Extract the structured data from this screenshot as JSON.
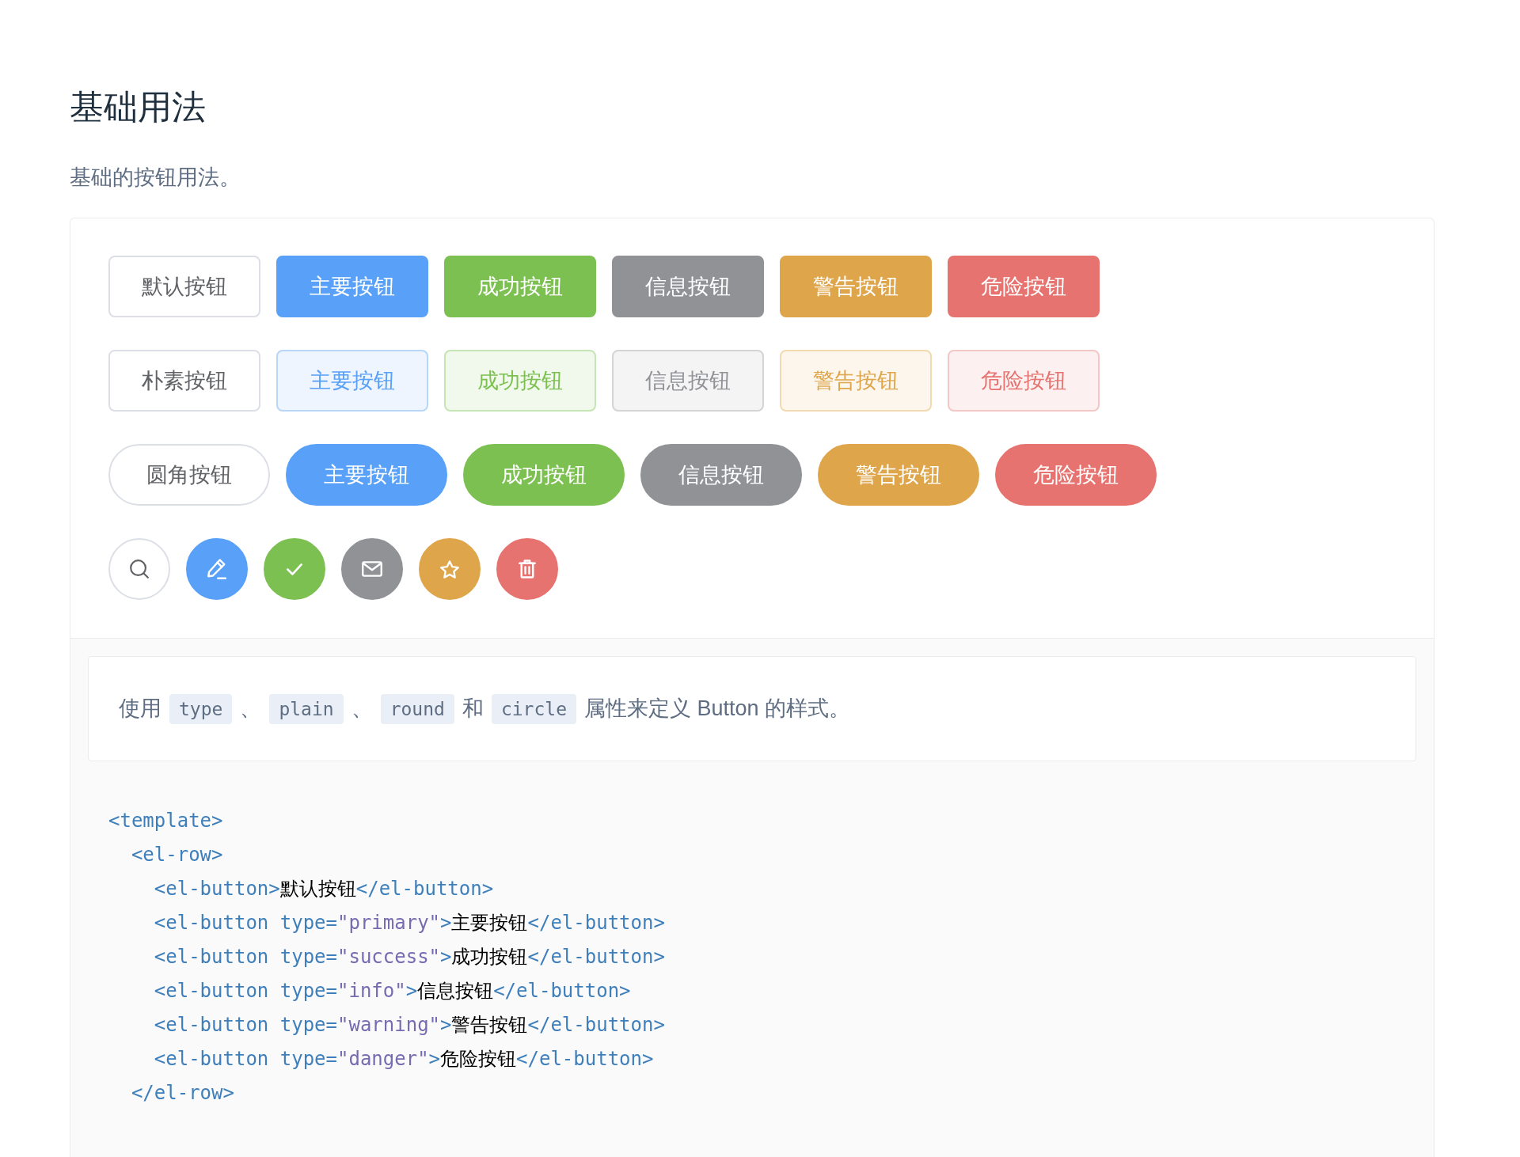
{
  "section": {
    "title": "基础用法",
    "description": "基础的按钮用法。"
  },
  "demo": {
    "rows": [
      {
        "kind": "solid",
        "buttons": [
          {
            "kind": "default",
            "label": "默认按钮"
          },
          {
            "kind": "primary",
            "label": "主要按钮"
          },
          {
            "kind": "success",
            "label": "成功按钮"
          },
          {
            "kind": "info",
            "label": "信息按钮"
          },
          {
            "kind": "warning",
            "label": "警告按钮"
          },
          {
            "kind": "danger",
            "label": "危险按钮"
          }
        ]
      },
      {
        "kind": "plain",
        "buttons": [
          {
            "kind": "default",
            "label": "朴素按钮"
          },
          {
            "kind": "primary",
            "label": "主要按钮"
          },
          {
            "kind": "success",
            "label": "成功按钮"
          },
          {
            "kind": "info",
            "label": "信息按钮"
          },
          {
            "kind": "warning",
            "label": "警告按钮"
          },
          {
            "kind": "danger",
            "label": "危险按钮"
          }
        ]
      },
      {
        "kind": "round",
        "buttons": [
          {
            "kind": "default",
            "label": "圆角按钮"
          },
          {
            "kind": "primary",
            "label": "主要按钮"
          },
          {
            "kind": "success",
            "label": "成功按钮"
          },
          {
            "kind": "info",
            "label": "信息按钮"
          },
          {
            "kind": "warning",
            "label": "警告按钮"
          },
          {
            "kind": "danger",
            "label": "危险按钮"
          }
        ]
      },
      {
        "kind": "circle",
        "buttons": [
          {
            "kind": "default"
          },
          {
            "kind": "primary"
          },
          {
            "kind": "success"
          },
          {
            "kind": "info"
          },
          {
            "kind": "warning"
          },
          {
            "kind": "danger"
          }
        ]
      }
    ]
  },
  "meta": {
    "description": [
      {
        "kind": "text",
        "text": "使用"
      },
      {
        "kind": "code",
        "text": "type"
      },
      {
        "kind": "text",
        "text": "、"
      },
      {
        "kind": "code",
        "text": "plain"
      },
      {
        "kind": "text",
        "text": "、"
      },
      {
        "kind": "code",
        "text": "round"
      },
      {
        "kind": "text",
        "text": "和"
      },
      {
        "kind": "code",
        "text": "circle"
      },
      {
        "kind": "text",
        "text": "属性来定义 Button 的样式。"
      }
    ],
    "code": [
      {
        "segments": [
          {
            "kind": "tag",
            "text": "<template>"
          }
        ],
        "children": [
          {
            "segments": [
              {
                "kind": "tag",
                "text": "<el-row>"
              }
            ],
            "children": [
              {
                "segments": [
                  {
                    "kind": "tag",
                    "text": "<el-button>"
                  },
                  {
                    "kind": "text",
                    "text": "默认按钮"
                  },
                  {
                    "kind": "tag",
                    "text": "</el-button>"
                  }
                ]
              },
              {
                "segments": [
                  {
                    "kind": "tag",
                    "text": "<el-button type="
                  },
                  {
                    "kind": "string",
                    "text": "\"primary\""
                  },
                  {
                    "kind": "tag",
                    "text": ">"
                  },
                  {
                    "kind": "text",
                    "text": "主要按钮"
                  },
                  {
                    "kind": "tag",
                    "text": "</el-button>"
                  }
                ]
              },
              {
                "segments": [
                  {
                    "kind": "tag",
                    "text": "<el-button type="
                  },
                  {
                    "kind": "string",
                    "text": "\"success\""
                  },
                  {
                    "kind": "tag",
                    "text": ">"
                  },
                  {
                    "kind": "text",
                    "text": "成功按钮"
                  },
                  {
                    "kind": "tag",
                    "text": "</el-button>"
                  }
                ]
              },
              {
                "segments": [
                  {
                    "kind": "tag",
                    "text": "<el-button type="
                  },
                  {
                    "kind": "string",
                    "text": "\"info\""
                  },
                  {
                    "kind": "tag",
                    "text": ">"
                  },
                  {
                    "kind": "text",
                    "text": "信息按钮"
                  },
                  {
                    "kind": "tag",
                    "text": "</el-button>"
                  }
                ]
              },
              {
                "segments": [
                  {
                    "kind": "tag",
                    "text": "<el-button type="
                  },
                  {
                    "kind": "string",
                    "text": "\"warning\""
                  },
                  {
                    "kind": "tag",
                    "text": ">"
                  },
                  {
                    "kind": "text",
                    "text": "警告按钮"
                  },
                  {
                    "kind": "tag",
                    "text": "</el-button>"
                  }
                ]
              },
              {
                "segments": [
                  {
                    "kind": "tag",
                    "text": "<el-button type="
                  },
                  {
                    "kind": "string",
                    "text": "\"danger\""
                  },
                  {
                    "kind": "tag",
                    "text": ">"
                  },
                  {
                    "kind": "text",
                    "text": "危险按钮"
                  },
                  {
                    "kind": "tag",
                    "text": "</el-button>"
                  }
                ]
              }
            ]
          },
          {
            "segments": [
              {
                "kind": "tag",
                "text": "</el-row>"
              }
            ]
          }
        ]
      }
    ]
  }
}
